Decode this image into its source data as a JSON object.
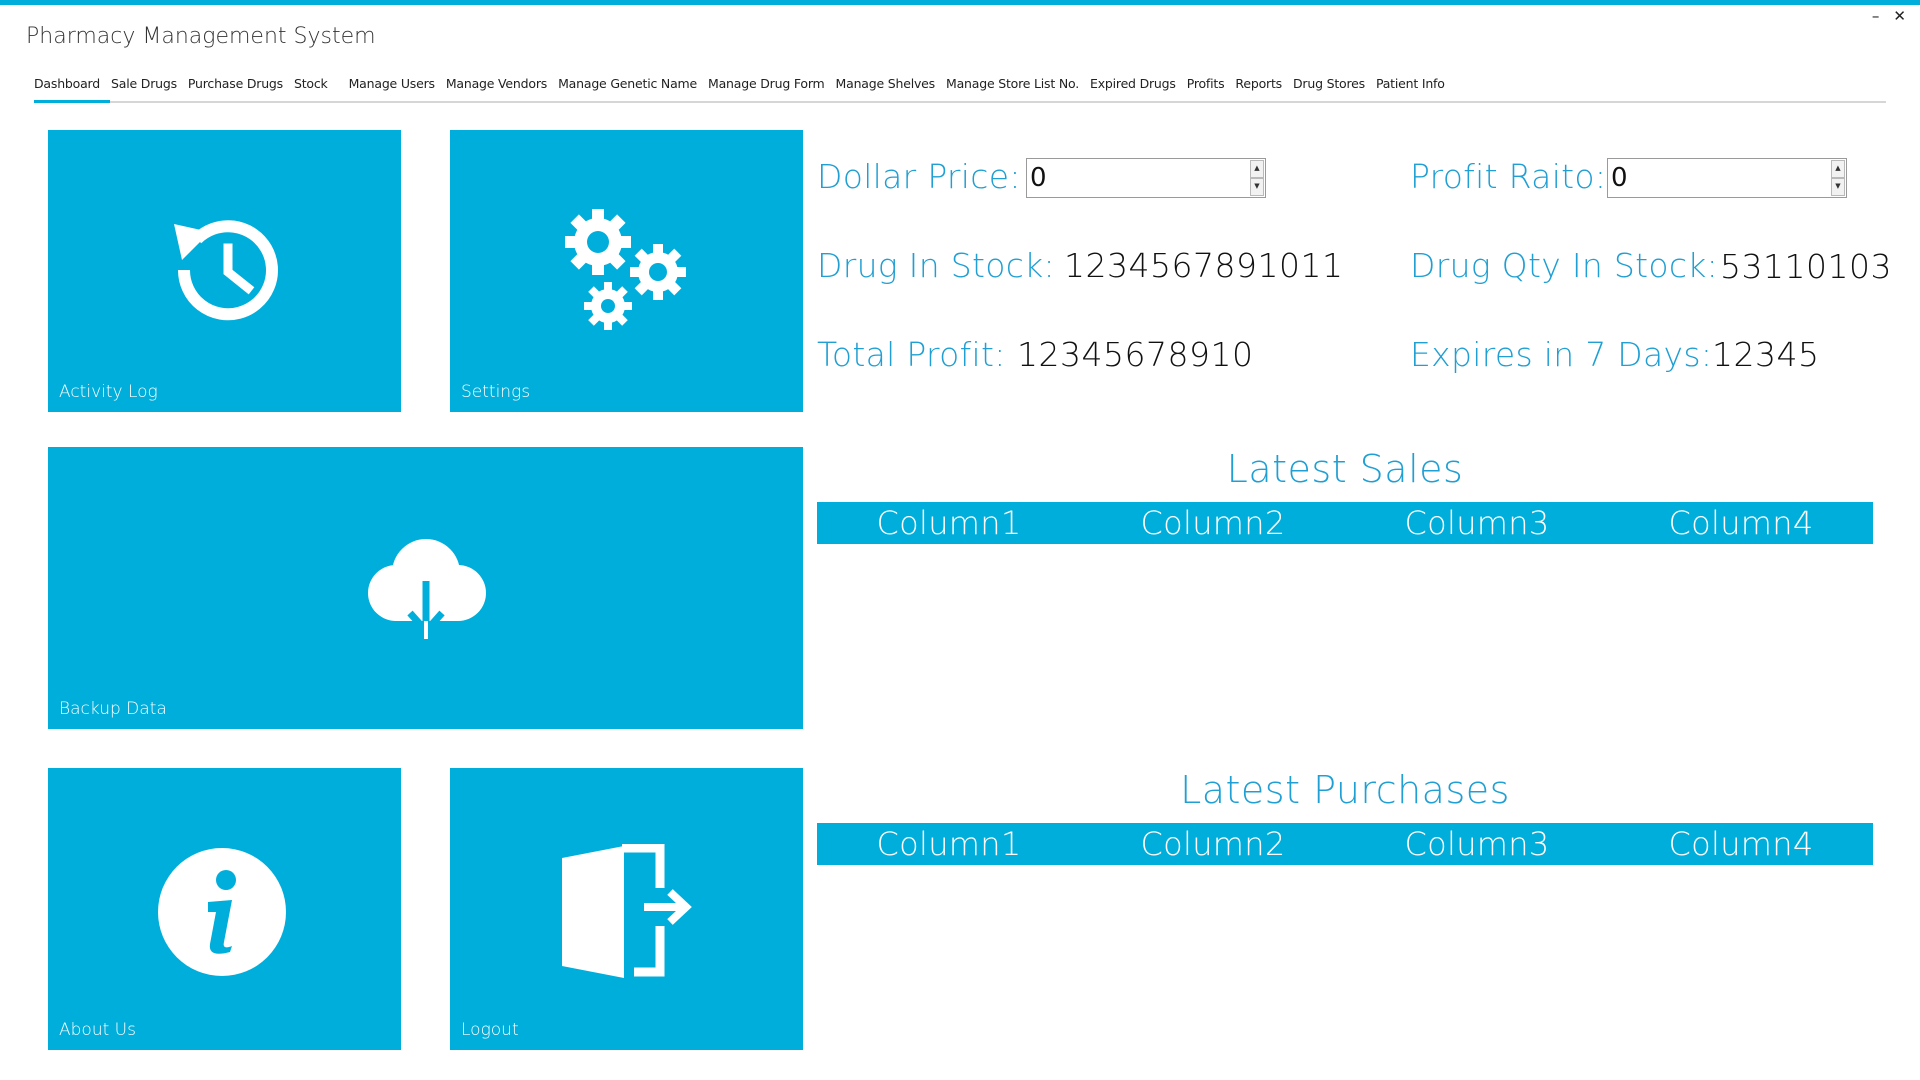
{
  "app": {
    "title": "Pharmacy Management System"
  },
  "window_controls": {
    "minimize": "–",
    "close": "✕"
  },
  "menu": {
    "items": [
      "Dashboard",
      "Sale Drugs",
      "Purchase Drugs",
      "Stock",
      "Manage Users",
      "Manage Vendors",
      "Manage Genetic Name",
      "Manage Drug Form",
      "Manage Shelves",
      "Manage Store List No.",
      "Expired Drugs",
      "Profits",
      "Reports",
      "Drug Stores",
      "Patient Info"
    ],
    "active": "Dashboard"
  },
  "tiles": {
    "activity_log": {
      "label": "Activity Log",
      "icon": "history-icon"
    },
    "settings": {
      "label": "Settings",
      "icon": "gears-icon"
    },
    "backup_data": {
      "label": "Backup Data",
      "icon": "cloud-download-icon"
    },
    "about_us": {
      "label": "About Us",
      "icon": "info-icon"
    },
    "logout": {
      "label": "Logout",
      "icon": "exit-door-icon"
    }
  },
  "stats": {
    "dollar_price": {
      "label": "Dollar Price:",
      "value": "0"
    },
    "profit_ratio": {
      "label": "Profit Raito:",
      "value": "0"
    },
    "drug_in_stock": {
      "label": "Drug In Stock:",
      "value": "1234567891011"
    },
    "drug_qty_in_stock": {
      "label": "Drug Qty In Stock:",
      "value": "53110103"
    },
    "total_profit": {
      "label": "Total Profit:",
      "value": "12345678910"
    },
    "expires_in_7_days": {
      "label": "Expires in 7 Days:",
      "value": "12345"
    }
  },
  "latest_sales": {
    "title": "Latest Sales",
    "columns": [
      "Column1",
      "Column2",
      "Column3",
      "Column4"
    ]
  },
  "latest_purchases": {
    "title": "Latest Purchases",
    "columns": [
      "Column1",
      "Column2",
      "Column3",
      "Column4"
    ]
  },
  "colors": {
    "accent": "#00AEDB",
    "label_text": "#1F9FD3",
    "tile_text": "#FFFFFF"
  }
}
